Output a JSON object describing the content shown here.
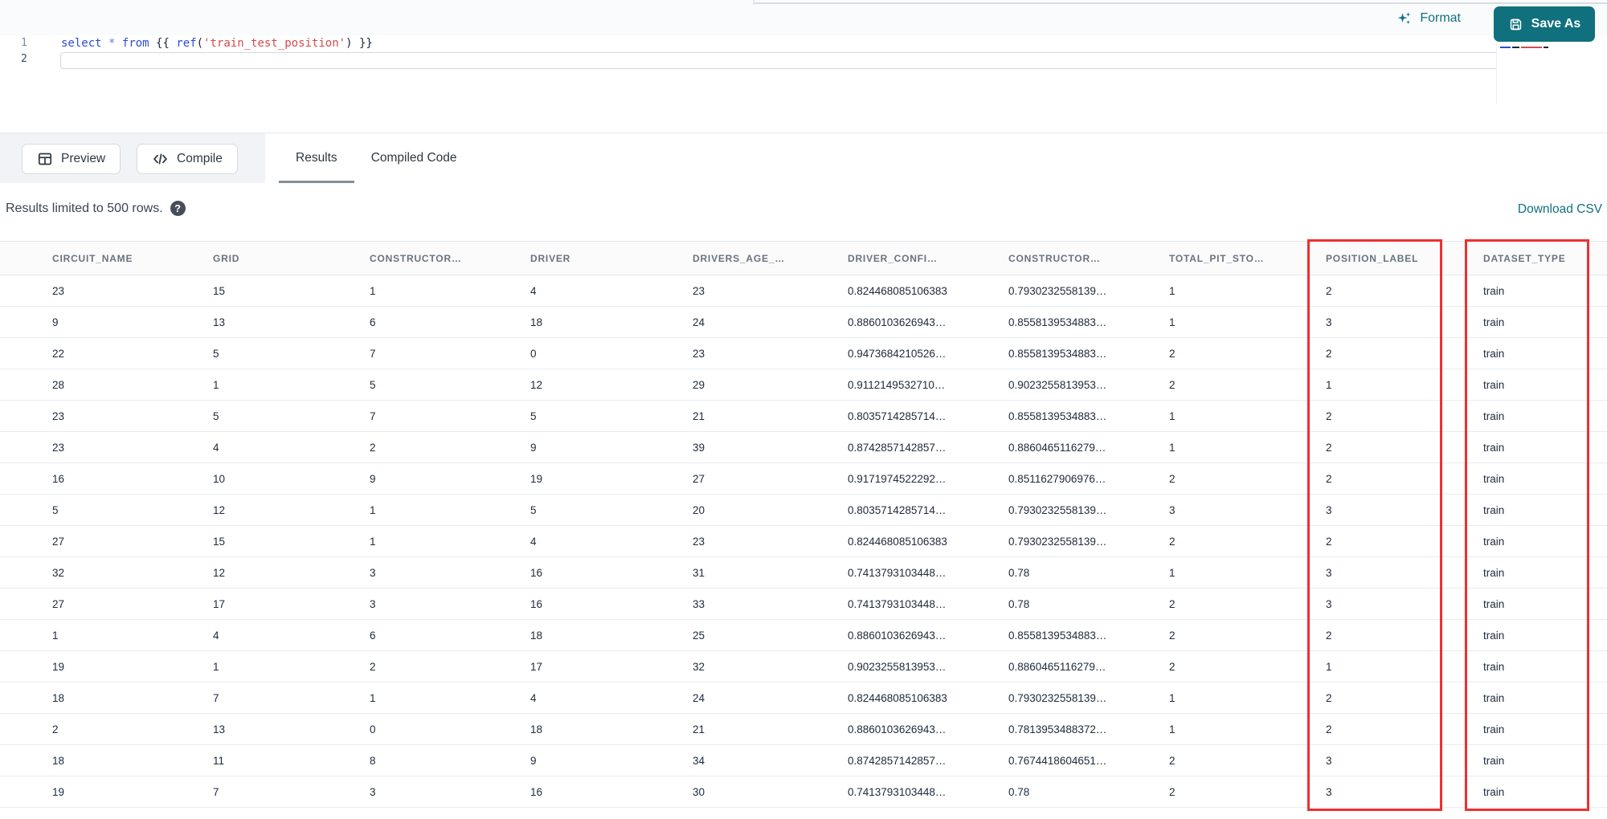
{
  "header": {
    "format_label": "Format",
    "save_as_label": "Save As"
  },
  "editor": {
    "line_numbers": [
      "1",
      "2"
    ],
    "code_text": "select * from {{ ref('train_test_position') }}",
    "code_tokens": [
      {
        "text": "select",
        "type": "keyword"
      },
      {
        "text": " ",
        "type": "plain"
      },
      {
        "text": "*",
        "type": "operator"
      },
      {
        "text": " ",
        "type": "plain"
      },
      {
        "text": "from",
        "type": "keyword"
      },
      {
        "text": " ",
        "type": "plain"
      },
      {
        "text": "{{ ",
        "type": "bracket"
      },
      {
        "text": "ref",
        "type": "function"
      },
      {
        "text": "(",
        "type": "bracket"
      },
      {
        "text": "'train_test_position'",
        "type": "string"
      },
      {
        "text": ")",
        "type": "bracket"
      },
      {
        "text": " }}",
        "type": "bracket"
      }
    ]
  },
  "toolbar": {
    "preview_label": "Preview",
    "compile_label": "Compile",
    "tabs": [
      {
        "label": "Results",
        "active": true
      },
      {
        "label": "Compiled Code",
        "active": false
      }
    ]
  },
  "results_bar": {
    "limit_text": "Results limited to 500 rows.",
    "help_glyph": "?",
    "download_label": "Download CSV"
  },
  "table": {
    "columns": [
      "CIRCUIT_NAME",
      "GRID",
      "CONSTRUCTOR…",
      "DRIVER",
      "DRIVERS_AGE_…",
      "DRIVER_CONFI…",
      "CONSTRUCTOR…",
      "TOTAL_PIT_STO…",
      "POSITION_LABEL",
      "DATASET_TYPE"
    ],
    "highlighted_columns": [
      "POSITION_LABEL",
      "DATASET_TYPE"
    ],
    "rows": [
      [
        "23",
        "15",
        "1",
        "4",
        "23",
        "0.824468085106383",
        "0.7930232558139…",
        "1",
        "2",
        "train"
      ],
      [
        "9",
        "13",
        "6",
        "18",
        "24",
        "0.8860103626943…",
        "0.8558139534883…",
        "1",
        "3",
        "train"
      ],
      [
        "22",
        "5",
        "7",
        "0",
        "23",
        "0.9473684210526…",
        "0.8558139534883…",
        "2",
        "2",
        "train"
      ],
      [
        "28",
        "1",
        "5",
        "12",
        "29",
        "0.9112149532710…",
        "0.9023255813953…",
        "2",
        "1",
        "train"
      ],
      [
        "23",
        "5",
        "7",
        "5",
        "21",
        "0.8035714285714…",
        "0.8558139534883…",
        "1",
        "2",
        "train"
      ],
      [
        "23",
        "4",
        "2",
        "9",
        "39",
        "0.8742857142857…",
        "0.8860465116279…",
        "1",
        "2",
        "train"
      ],
      [
        "16",
        "10",
        "9",
        "19",
        "27",
        "0.9171974522292…",
        "0.8511627906976…",
        "2",
        "2",
        "train"
      ],
      [
        "5",
        "12",
        "1",
        "5",
        "20",
        "0.8035714285714…",
        "0.7930232558139…",
        "3",
        "3",
        "train"
      ],
      [
        "27",
        "15",
        "1",
        "4",
        "23",
        "0.824468085106383",
        "0.7930232558139…",
        "2",
        "2",
        "train"
      ],
      [
        "32",
        "12",
        "3",
        "16",
        "31",
        "0.7413793103448…",
        "0.78",
        "1",
        "3",
        "train"
      ],
      [
        "27",
        "17",
        "3",
        "16",
        "33",
        "0.7413793103448…",
        "0.78",
        "2",
        "3",
        "train"
      ],
      [
        "1",
        "4",
        "6",
        "18",
        "25",
        "0.8860103626943…",
        "0.8558139534883…",
        "2",
        "2",
        "train"
      ],
      [
        "19",
        "1",
        "2",
        "17",
        "32",
        "0.9023255813953…",
        "0.8860465116279…",
        "2",
        "1",
        "train"
      ],
      [
        "18",
        "7",
        "1",
        "4",
        "24",
        "0.824468085106383",
        "0.7930232558139…",
        "1",
        "2",
        "train"
      ],
      [
        "2",
        "13",
        "0",
        "18",
        "21",
        "0.8860103626943…",
        "0.7813953488372…",
        "1",
        "2",
        "train"
      ],
      [
        "18",
        "11",
        "8",
        "9",
        "34",
        "0.8742857142857…",
        "0.7674418604651…",
        "2",
        "3",
        "train"
      ],
      [
        "19",
        "7",
        "3",
        "16",
        "30",
        "0.7413793103448…",
        "0.78",
        "2",
        "3",
        "train"
      ]
    ]
  },
  "colors": {
    "accent_teal": "#11707d",
    "highlight_red": "#ef2f2f",
    "keyword_blue": "#2a4bd7",
    "string_red": "#d64a4a"
  }
}
